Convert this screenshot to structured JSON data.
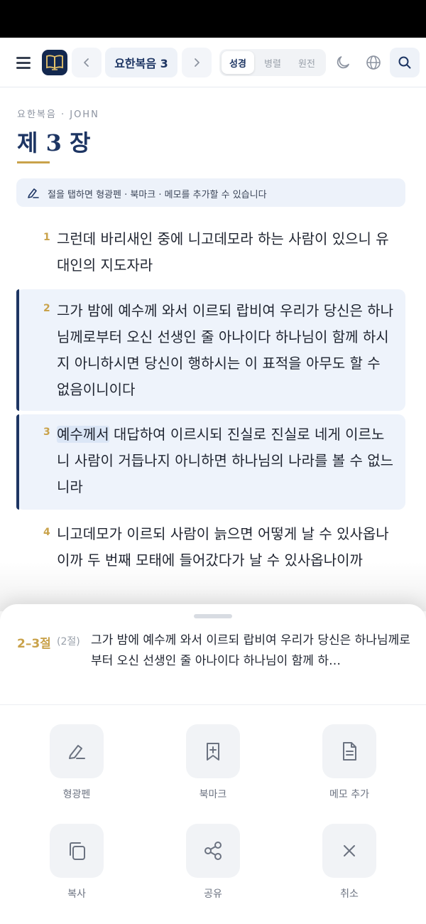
{
  "header": {
    "chapter_pill": "요한복음 3",
    "translation_tabs": [
      {
        "label": "성경",
        "active": true
      },
      {
        "label": "병렬",
        "active": false
      },
      {
        "label": "원전",
        "active": false
      }
    ]
  },
  "page": {
    "book_label": "요한복음 · JOHN",
    "chapter_title": "제 3 장"
  },
  "tip": {
    "text": "절을 탭하면 형광펜 · 북마크 · 메모를 추가할 수 있습니다"
  },
  "verses": [
    {
      "number": "1",
      "text": "그런데 바리새인 중에 니고데모라 하는 사람이 있으니 유대인의 지도자라",
      "selected": false
    },
    {
      "number": "2",
      "text": "그가 밤에 예수께 와서 이르되 랍비여 우리가 당신은 하나님께로부터 오신 선생인 줄 아나이다 하나님이 함께 하시지 아니하시면 당신이 행하시는 이 표적을 아무도 할 수 없음이니이다",
      "selected": true
    },
    {
      "number": "3",
      "highlight": "예수께서",
      "text": " 대답하여 이르시되 진실로 진실로 네게 이르노니 사람이 거듭나지 아니하면 하나님의 나라를 볼 수 없느니라",
      "selected": true
    },
    {
      "number": "4",
      "text": "니고데모가 이르되 사람이 늙으면 어떻게 날 수 있사옵나이까 두 번째 모태에 들어갔다가 날 수 있사옵나이까",
      "selected": false
    }
  ],
  "sheet": {
    "range": "2–3절",
    "count": "(2절)",
    "preview": "그가 밤에 예수께 와서 이르되 랍비여 우리가 당신은 하나님께로부터 오신 선생인 줄 아나이다 하나님이 함께 하…",
    "actions": [
      {
        "label": "형광펜",
        "icon": "highlighter-icon"
      },
      {
        "label": "북마크",
        "icon": "bookmark-add-icon"
      },
      {
        "label": "메모 추가",
        "icon": "note-icon"
      },
      {
        "label": "복사",
        "icon": "copy-icon"
      },
      {
        "label": "공유",
        "icon": "share-icon"
      },
      {
        "label": "취소",
        "icon": "close-icon"
      }
    ]
  },
  "colors": {
    "primary_navy": "#1d3563",
    "accent_gold": "#c9a24a",
    "selection_bg": "#eef3fb"
  }
}
